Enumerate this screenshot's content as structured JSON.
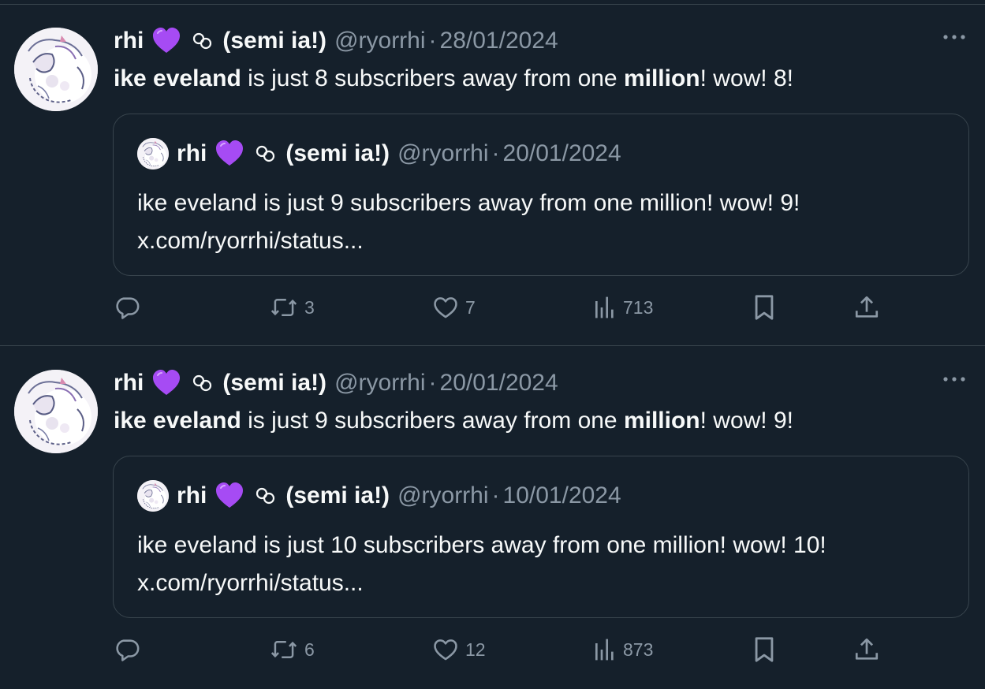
{
  "colors": {
    "background": "#15202b",
    "text_primary": "#f7f9f9",
    "text_secondary": "#8b98a5",
    "border": "#38444d",
    "heart_emoji": "#a64bf4"
  },
  "tweets": [
    {
      "author": {
        "name_prefix": "rhi",
        "name_suffix": "(semi ia!)",
        "handle": "@ryorrhi",
        "separator": "·",
        "date": "28/01/2024"
      },
      "text": {
        "bold1": "ike eveland",
        "part2": " is just 8 subscribers away from one ",
        "bold2": "million",
        "part3": "! wow! 8!"
      },
      "quote": {
        "name_prefix": "rhi",
        "name_suffix": "(semi ia!)",
        "handle": "@ryorrhi",
        "separator": "·",
        "date": "20/01/2024",
        "line1": "ike eveland is just 9 subscribers away from one million! wow! 9!",
        "line2": "x.com/ryorrhi/status..."
      },
      "stats": {
        "retweets": "3",
        "likes": "7",
        "views": "713"
      }
    },
    {
      "author": {
        "name_prefix": "rhi",
        "name_suffix": "(semi ia!)",
        "handle": "@ryorrhi",
        "separator": "·",
        "date": "20/01/2024"
      },
      "text": {
        "bold1": "ike eveland",
        "part2": " is just 9 subscribers away from one ",
        "bold2": "million",
        "part3": "! wow! 9!"
      },
      "quote": {
        "name_prefix": "rhi",
        "name_suffix": "(semi ia!)",
        "handle": "@ryorrhi",
        "separator": "·",
        "date": "10/01/2024",
        "line1": "ike eveland is just 10 subscribers away from one million! wow! 10!",
        "line2": "x.com/ryorrhi/status..."
      },
      "stats": {
        "retweets": "6",
        "likes": "12",
        "views": "873"
      }
    }
  ],
  "icons": {
    "name_emoji": "purple-heart-icon",
    "name_symbol": "link-symbol-icon",
    "more": "more-dots-icon",
    "reply": "reply-bubble-icon",
    "retweet": "retweet-icon",
    "like": "heart-outline-icon",
    "views": "views-bars-icon",
    "bookmark": "bookmark-icon",
    "share": "share-upload-icon"
  }
}
